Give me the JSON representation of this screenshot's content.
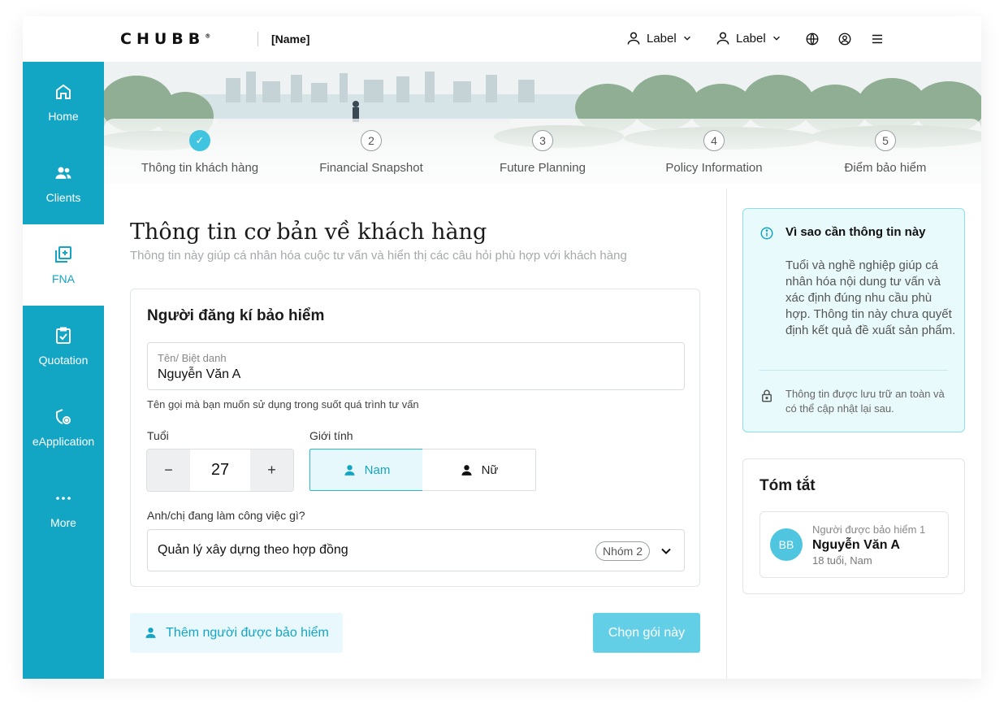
{
  "header": {
    "logo_text": "CHUBB",
    "logo_mark": "®",
    "brand_name": "[Name]",
    "user_menu_1": "Label",
    "user_menu_2": "Label"
  },
  "sidebar": {
    "items": [
      {
        "label": "Home",
        "icon": "home-icon"
      },
      {
        "label": "Clients",
        "icon": "users-icon"
      },
      {
        "label": "FNA",
        "icon": "add-box-icon",
        "active": true
      },
      {
        "label": "Quotation",
        "icon": "clipboard-check-icon"
      },
      {
        "label": "eApplication",
        "icon": "shield-gear-icon"
      },
      {
        "label": "More",
        "icon": "more-dots-icon"
      }
    ]
  },
  "stepper": {
    "steps": [
      {
        "number": "1",
        "label": "Thông tin khách hàng",
        "done": true
      },
      {
        "number": "2",
        "label": "Financial Snapshot"
      },
      {
        "number": "3",
        "label": "Future Planning"
      },
      {
        "number": "4",
        "label": "Policy Information"
      },
      {
        "number": "5",
        "label": "Điểm bảo hiểm"
      }
    ]
  },
  "main": {
    "title": "Thông tin cơ bản về khách hàng",
    "subtitle": "Thông tin này giúp cá nhân hóa cuộc tư vấn và hiển thị các câu hỏi phù hợp với khách hàng"
  },
  "form": {
    "card_title": "Người đăng kí bảo hiểm",
    "name_label": "Tên/ Biệt danh",
    "name_value": "Nguyễn Văn A",
    "name_helper": "Tên gọi mà bạn muốn sử dụng trong suốt quá trình tư vấn",
    "age_label": "Tuổi",
    "age_value": "27",
    "minus": "−",
    "plus": "+",
    "gender_label": "Giới tính",
    "gender_male": "Nam",
    "gender_female": "Nữ",
    "job_label": "Anh/chị đang làm công việc gì?",
    "job_value": "Quản lý xây dựng theo hợp đồng",
    "job_badge": "Nhóm 2"
  },
  "actions": {
    "add_insured": "Thêm người được bảo hiểm",
    "choose_package": "Chọn gói này"
  },
  "info": {
    "title": "Vì sao cần thông tin này",
    "body": "Tuổi và nghề nghiệp giúp cá nhân hóa nội dung tư vấn và xác định đúng nhu cầu phù hợp. Thông tin này chưa quyết định kết quả đề xuất sản phẩm.",
    "note": "Thông tin được lưu trữ an toàn và có thể cập nhật lại sau."
  },
  "summary": {
    "title": "Tóm tắt",
    "avatar_initials": "BB",
    "role": "Người được bảo hiểm 1",
    "name": "Nguyễn Văn A",
    "meta": "18 tuổi, Nam"
  },
  "colors": {
    "primary": "#13a5c4",
    "accent_light": "#e9fafc",
    "button_primary": "#63cfe6"
  }
}
